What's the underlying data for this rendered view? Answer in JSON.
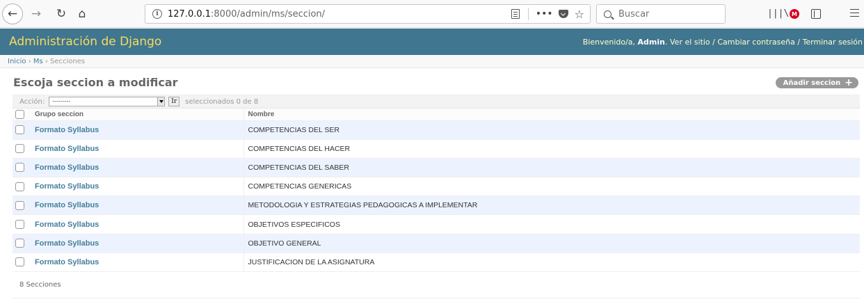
{
  "browser": {
    "url_host": "127.0.0.1",
    "url_path": ":8000/admin/ms/seccion/",
    "search_placeholder": "Buscar",
    "ext_badge": "M"
  },
  "header": {
    "site_name": "Administración de Django",
    "welcome": "Bienvenido/a,",
    "user": "Admin",
    "view_site": "Ver el sitio",
    "change_password": "Cambiar contraseña",
    "logout": "Terminar sesión",
    "sep": " / "
  },
  "breadcrumbs": {
    "home": "Inicio",
    "app": "Ms",
    "current": "Secciones",
    "sep": " › "
  },
  "page": {
    "title": "Escoja seccion a modificar",
    "add_label": "Añadir seccion",
    "add_symbol": "+"
  },
  "actions": {
    "label": "Acción:",
    "selected_value": "---------",
    "go_label": "Ir",
    "selected_count": "seleccionados 0 de 8"
  },
  "table": {
    "columns": [
      "Grupo seccion",
      "Nombre"
    ],
    "rows": [
      {
        "grupo": "Formato Syllabus",
        "nombre": "COMPETENCIAS DEL SER"
      },
      {
        "grupo": "Formato Syllabus",
        "nombre": "COMPETENCIAS DEL HACER"
      },
      {
        "grupo": "Formato Syllabus",
        "nombre": "COMPETENCIAS DEL SABER"
      },
      {
        "grupo": "Formato Syllabus",
        "nombre": "COMPETENCIAS GENERICAS"
      },
      {
        "grupo": "Formato Syllabus",
        "nombre": "METODOLOGIA Y ESTRATEGIAS PEDAGOGICAS A IMPLEMENTAR"
      },
      {
        "grupo": "Formato Syllabus",
        "nombre": "OBJETIVOS ESPECIFICOS"
      },
      {
        "grupo": "Formato Syllabus",
        "nombre": "OBJETIVO GENERAL"
      },
      {
        "grupo": "Formato Syllabus",
        "nombre": "JUSTIFICACION DE LA ASIGNATURA"
      }
    ]
  },
  "paginator": {
    "text": "8 Secciones"
  },
  "colors": {
    "header_bg": "#417690",
    "site_name": "#f5dd5d",
    "link": "#447e9b",
    "row_alt": "#edf3fe"
  }
}
